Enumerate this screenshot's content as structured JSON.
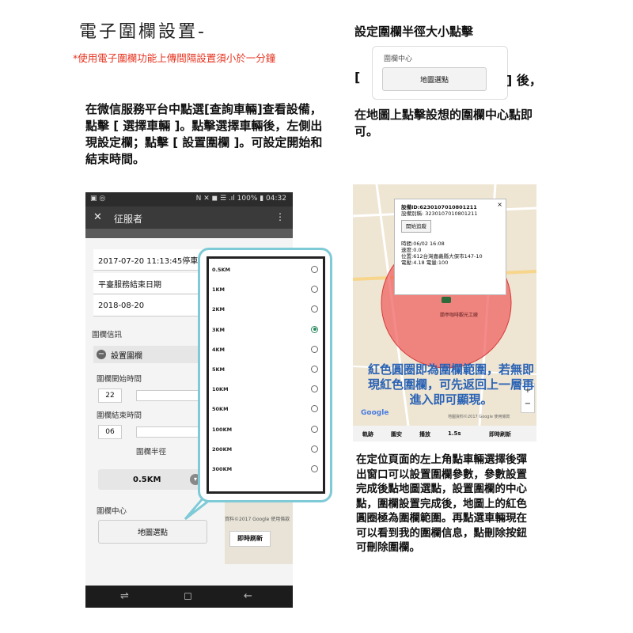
{
  "title": "電子圍欄設置-",
  "warning": "*使用電子圍欄功能上傳間隔設置須小於一分鐘",
  "left_instructions": "在微信服務平台中點選[查詢車輛]查看設備，點擊 [ 選擇車輛 ]。點擊選擇車輛後，左側出現設定欄；點擊 [ 設置圍欄 ]。可設定開始和結束時間。",
  "right_top": {
    "title": "設定圍欄半徑大小點擊",
    "card_label": "圍欄中心",
    "card_button": "地圖選點",
    "bracket_open": "[",
    "bracket_close": "] 後，",
    "instruction": "在地圖上點擊設想的圍欄中心點即可。"
  },
  "phone": {
    "status_left": "▣ ◎",
    "status_right": "N ✕ ◼ ☰ .ıl 100% ▮ 04:32",
    "app_close": "✕",
    "app_title": "征服者",
    "app_menu": "⋮",
    "stop_time": "2017-07-20 11:13:45停車",
    "service_end_label": "平臺服務結束日期",
    "service_end_date": "2018-08-20",
    "fence_info": "圍欄信訊",
    "set_fence": "設置圍欄",
    "start_time_label": "圍欄開始時間",
    "start_value": "22",
    "end_time_label": "圍欄結束時間",
    "end_value": "06",
    "radius_label": "圍欄半徑",
    "radius_value": "0.5KM",
    "center_label": "圍欄中心",
    "map_pick_button": "地圖選點",
    "refresh_button": "即時刷新",
    "map_credit": "資料©2017 Google  使用條款",
    "nav_back": "⇌",
    "nav_home": "◻",
    "nav_recent": "←"
  },
  "radius_options": [
    {
      "label": "0.5KM",
      "selected": false
    },
    {
      "label": "1KM",
      "selected": false
    },
    {
      "label": "2KM",
      "selected": false
    },
    {
      "label": "3KM",
      "selected": true
    },
    {
      "label": "4KM",
      "selected": false
    },
    {
      "label": "5KM",
      "selected": false
    },
    {
      "label": "10KM",
      "selected": false
    },
    {
      "label": "50KM",
      "selected": false
    },
    {
      "label": "100KM",
      "selected": false
    },
    {
      "label": "200KM",
      "selected": false
    },
    {
      "label": "300KM",
      "selected": false
    }
  ],
  "map": {
    "device_id": "設備ID:6230107010801211",
    "device_name": "設備別稱:     3230107010801211",
    "track_button": "開始追蹤",
    "time": "時間:06/02 16:08",
    "speed": "速度:0.0",
    "position": "位置:612台灣嘉義縣大保市147-10",
    "voltage": "電壓:4.18 電量:100",
    "poi": "蘭亭咖啡觀光工廠",
    "bottom_items": [
      "軌跡",
      "圍安",
      "播放",
      "1.5s",
      "即時刷新"
    ],
    "google": "Google",
    "credit": "地圖資料©2017 Google  使用條款",
    "overlay_text": "紅色圓圈即為圍欄範圍，若無即現紅色圍欄，可先返回上一層再進入即可顯現。"
  },
  "bottom_instructions": "在定位頁面的左上角點車輛選擇後彈出窗口可以設置圍欄參數，參數設置完成後點地圖選點，設置圍欄的中心點，圍欄設置完成後，地圖上的紅色圓圈極為圍欄範圍。再點選車輛現在可以看到我的圍欄信息，點刪除按鈕可刪除圍欄。",
  "colors": {
    "warning": "#e6331f",
    "popup_border": "#7ecad6",
    "fence": "#f05a5a",
    "overlay_text": "#2b63b4",
    "radio_selected": "#2c8a5e"
  }
}
